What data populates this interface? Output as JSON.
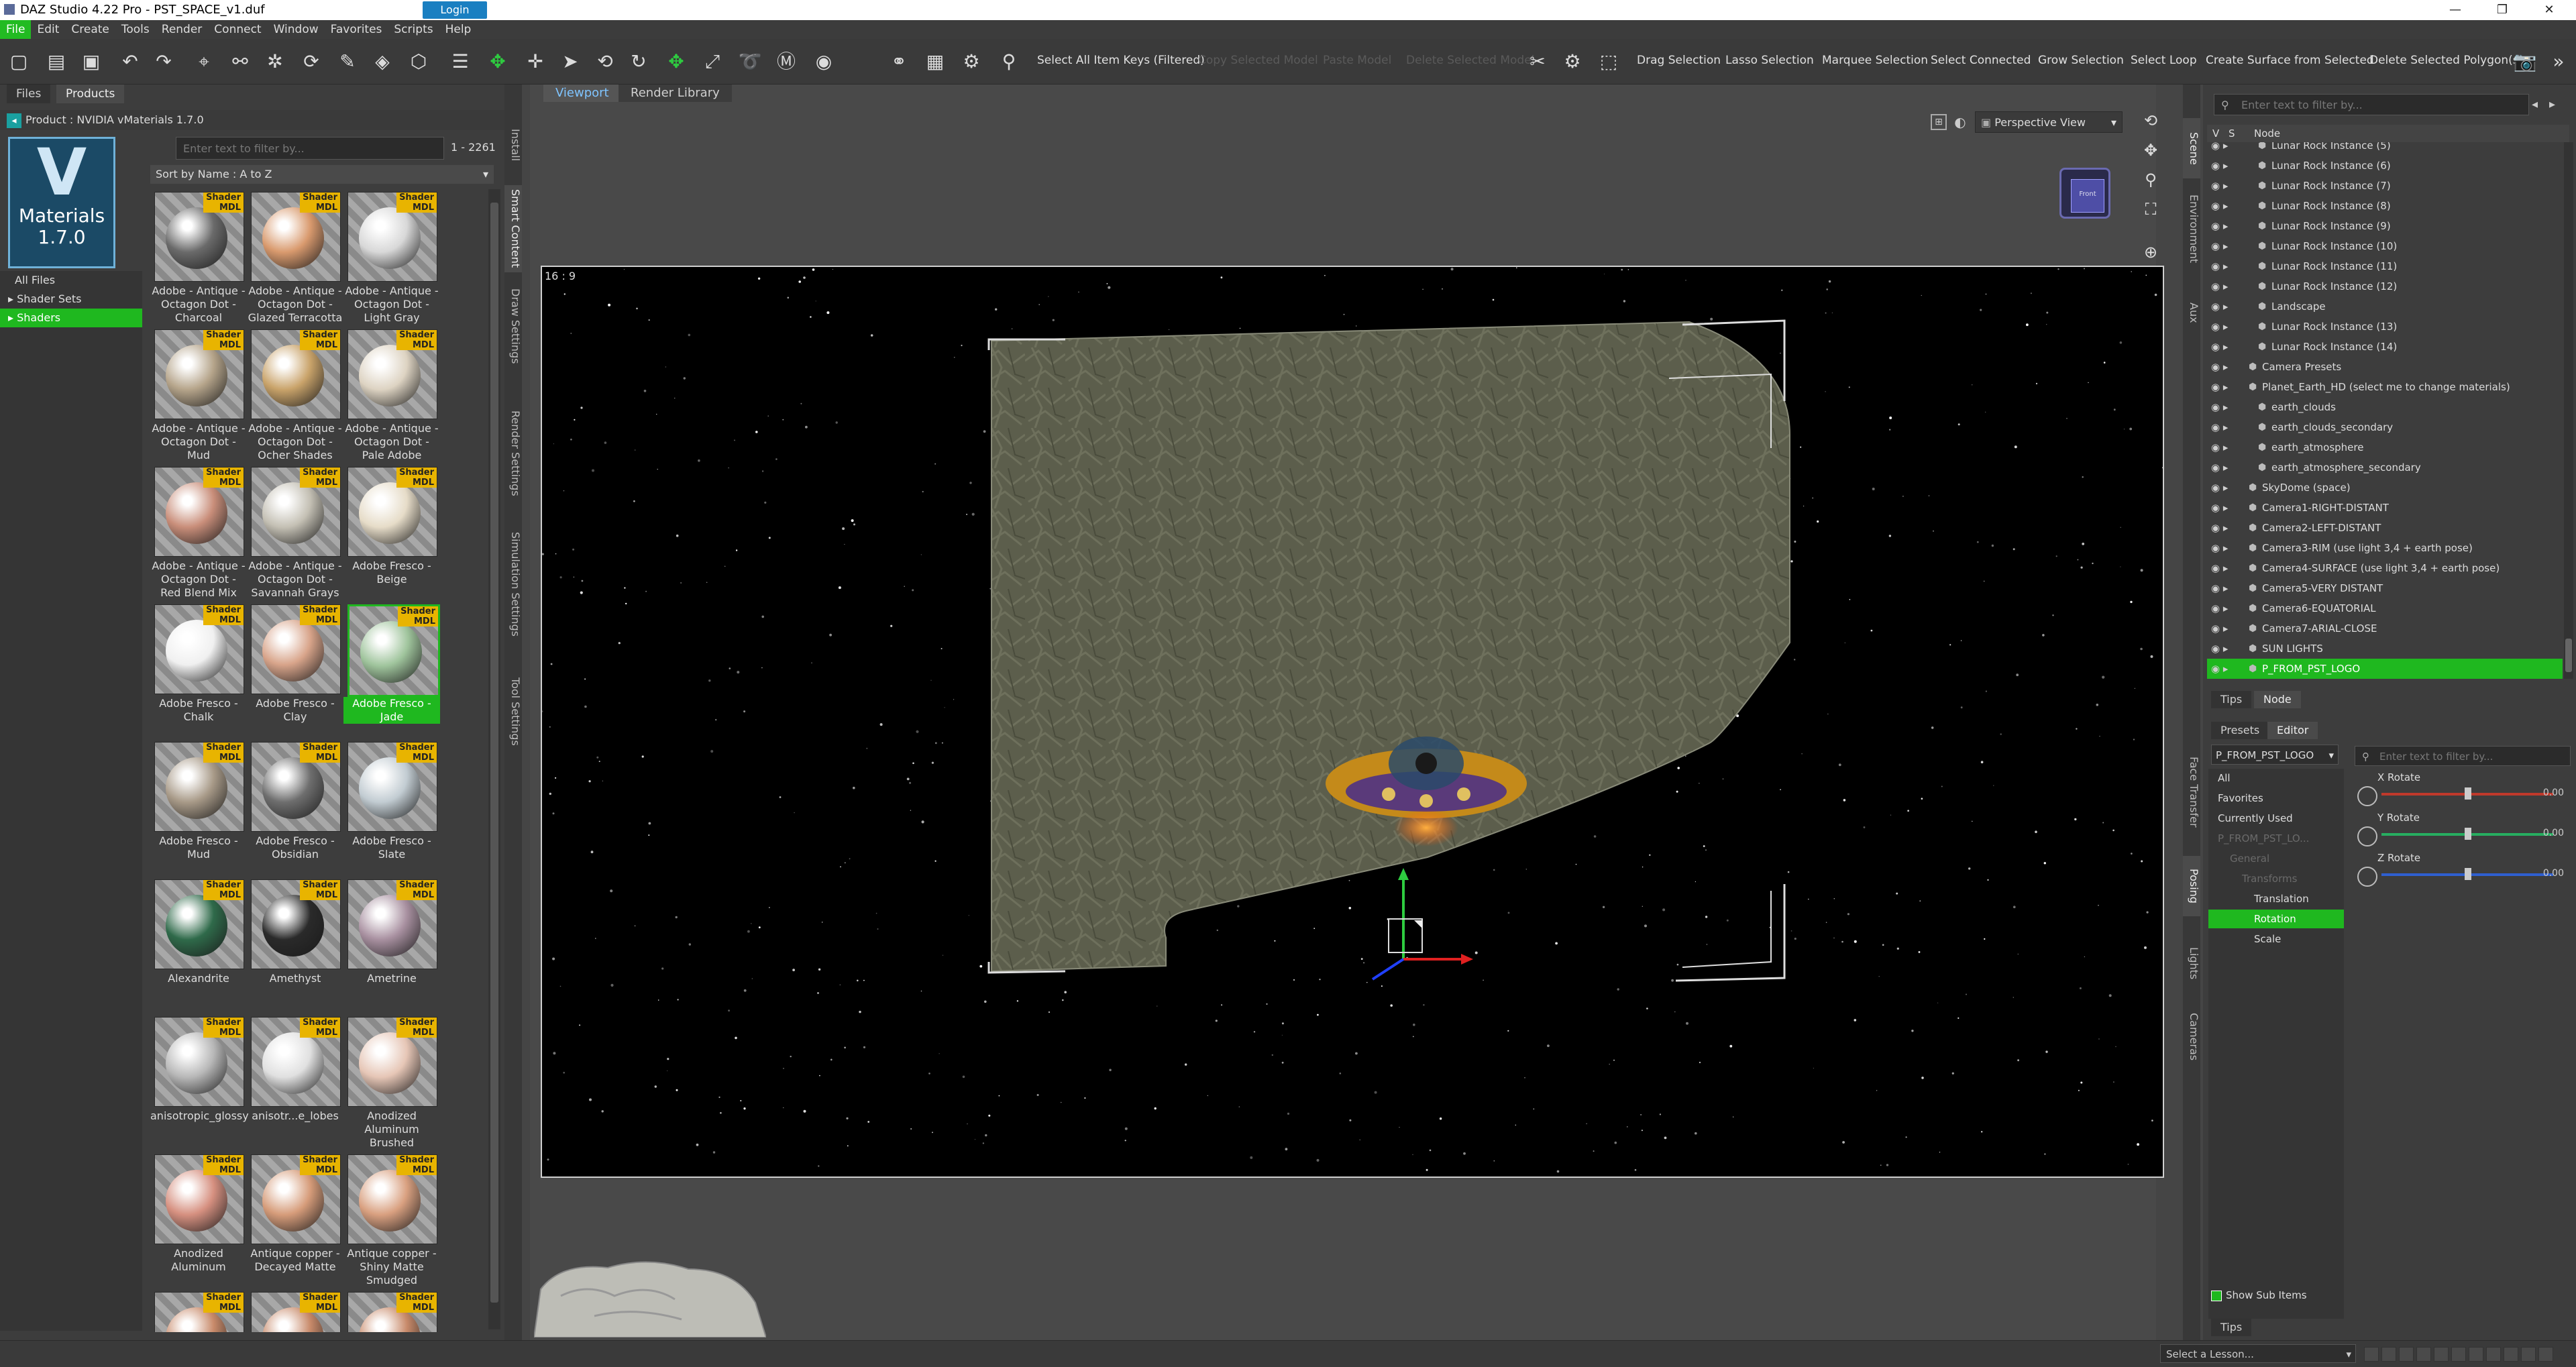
{
  "window": {
    "title": "DAZ Studio 4.22 Pro - PST_SPACE_v1.duf",
    "minimize": "—",
    "maximize": "❐",
    "close": "✕"
  },
  "menu": [
    "File",
    "Edit",
    "Create",
    "Tools",
    "Render",
    "Connect",
    "Window",
    "Favorites",
    "Scripts",
    "Help"
  ],
  "toolbar": {
    "select_keys": "Select All Item Keys (Filtered)",
    "dim_labels": [
      "Copy Selected Model",
      "Paste Model",
      "Delete Selected Model"
    ],
    "labels": [
      "Drag Selection",
      "Lasso Selection",
      "Marquee Selection",
      "Select Connected",
      "Grow Selection",
      "Select Loop",
      "Create Surface from Selected",
      "Delete Selected Polygon(s)"
    ]
  },
  "left": {
    "tabs": [
      "Files",
      "Products"
    ],
    "login": "Login",
    "product": "Product : NVIDIA vMaterials 1.7.0",
    "logo": {
      "letter": "V",
      "word": "Materials",
      "version": "1.7.0"
    },
    "tree": [
      {
        "label": "All Files",
        "selected": false,
        "prefix": ""
      },
      {
        "label": "Shader Sets",
        "selected": false,
        "prefix": "▸ "
      },
      {
        "label": "Shaders",
        "selected": true,
        "prefix": "▸ "
      }
    ],
    "filter_placeholder": "Enter text to filter by...",
    "count": "1 - 2261",
    "sort": "Sort by Name : A to Z",
    "badge": "Shader MDL",
    "items": [
      {
        "caption": "Adobe - Antique - Octagon Dot - Charcoal",
        "color": "#6a6a6a",
        "selected": false
      },
      {
        "caption": "Adobe - Antique - Octagon Dot - Glazed Terracotta",
        "color": "#d99a6e",
        "selected": false
      },
      {
        "caption": "Adobe - Antique - Octagon Dot - Light Gray",
        "color": "#d8d8d8",
        "selected": false
      },
      {
        "caption": "Adobe - Antique - Octagon Dot - Mud",
        "color": "#b5a48a",
        "selected": false
      },
      {
        "caption": "Adobe - Antique - Octagon Dot - Ocher Shades",
        "color": "#c9a36a",
        "selected": false
      },
      {
        "caption": "Adobe - Antique - Octagon Dot - Pale Adobe",
        "color": "#ddd3c2",
        "selected": false
      },
      {
        "caption": "Adobe - Antique - Octagon Dot - Red Blend Mix",
        "color": "#c98e7a",
        "selected": false
      },
      {
        "caption": "Adobe - Antique - Octagon Dot - Savannah Grays",
        "color": "#c4c0b4",
        "selected": false
      },
      {
        "caption": "Adobe Fresco - Beige",
        "color": "#e6dcc8",
        "selected": false
      },
      {
        "caption": "Adobe Fresco - Chalk",
        "color": "#f0f0f0",
        "selected": false
      },
      {
        "caption": "Adobe Fresco - Clay",
        "color": "#d8a48a",
        "selected": false
      },
      {
        "caption": "Adobe Fresco - Jade",
        "color": "#9fc49c",
        "selected": true
      },
      {
        "caption": "Adobe Fresco - Mud",
        "color": "#a89a88",
        "selected": false
      },
      {
        "caption": "Adobe Fresco - Obsidian",
        "color": "#6e6e6e",
        "selected": false
      },
      {
        "caption": "Adobe Fresco - Slate",
        "color": "#c2ccd2",
        "selected": false
      },
      {
        "caption": "Alexandrite",
        "color": "#2f6a4a",
        "selected": false
      },
      {
        "caption": "Amethyst",
        "color": "#2a2a2a",
        "selected": false
      },
      {
        "caption": "Ametrine",
        "color": "#a890a0",
        "selected": false
      },
      {
        "caption": "anisotropic_glossy",
        "color": "#b8b8b8",
        "selected": false
      },
      {
        "caption": "anisotr...e_lobes",
        "color": "#e0e0e0",
        "selected": false
      },
      {
        "caption": "Anodized Aluminum Brushed",
        "color": "#e6c6b6",
        "selected": false
      },
      {
        "caption": "Anodized Aluminum",
        "color": "#d69080",
        "selected": false
      },
      {
        "caption": "Antique copper - Decayed Matte",
        "color": "#d69c7a",
        "selected": false
      },
      {
        "caption": "Antique copper - Shiny Matte Smudged",
        "color": "#d9a080",
        "selected": false
      },
      {
        "caption": "",
        "color": "#c88a6a",
        "selected": false
      },
      {
        "caption": "",
        "color": "#c88a6a",
        "selected": false
      },
      {
        "caption": "",
        "color": "#c88a6a",
        "selected": false
      }
    ]
  },
  "side_tabs_left": [
    "Install",
    "Smart Content",
    "Draw Settings",
    "Render Settings",
    "Simulation Settings",
    "Tool Settings"
  ],
  "viewport": {
    "tabs": [
      "Viewport",
      "Render Library"
    ],
    "view": "Perspective View",
    "aspect": "16 : 9",
    "cube_label": "Front"
  },
  "side_tabs_right": [
    "Scene",
    "Environment",
    "Aux"
  ],
  "side_tabs_right2": [
    "Face Transfer",
    "Posing",
    "Lights",
    "Cameras"
  ],
  "scene": {
    "filter_placeholder": "Enter text to filter by...",
    "head_v": "V",
    "head_s": "S",
    "head_node": "Node",
    "rows": [
      {
        "name": "Lunar Rock Instance (5)",
        "indent": 2,
        "selected": false
      },
      {
        "name": "Lunar Rock Instance (6)",
        "indent": 2,
        "selected": false
      },
      {
        "name": "Lunar Rock Instance (7)",
        "indent": 2,
        "selected": false
      },
      {
        "name": "Lunar Rock Instance (8)",
        "indent": 2,
        "selected": false
      },
      {
        "name": "Lunar Rock Instance (9)",
        "indent": 2,
        "selected": false
      },
      {
        "name": "Lunar Rock Instance (10)",
        "indent": 2,
        "selected": false
      },
      {
        "name": "Lunar Rock Instance (11)",
        "indent": 2,
        "selected": false
      },
      {
        "name": "Lunar Rock Instance (12)",
        "indent": 2,
        "selected": false
      },
      {
        "name": "Landscape",
        "indent": 2,
        "selected": false
      },
      {
        "name": "Lunar Rock Instance (13)",
        "indent": 2,
        "selected": false
      },
      {
        "name": "Lunar Rock Instance (14)",
        "indent": 2,
        "selected": false
      },
      {
        "name": "Camera Presets",
        "indent": 1,
        "selected": false
      },
      {
        "name": "Planet_Earth_HD (select me to change materials)",
        "indent": 1,
        "selected": false
      },
      {
        "name": "earth_clouds",
        "indent": 2,
        "selected": false
      },
      {
        "name": "earth_clouds_secondary",
        "indent": 2,
        "selected": false
      },
      {
        "name": "earth_atmosphere",
        "indent": 2,
        "selected": false
      },
      {
        "name": "earth_atmosphere_secondary",
        "indent": 2,
        "selected": false
      },
      {
        "name": "SkyDome (space)",
        "indent": 1,
        "selected": false
      },
      {
        "name": "Camera1-RIGHT-DISTANT",
        "indent": 1,
        "selected": false
      },
      {
        "name": "Camera2-LEFT-DISTANT",
        "indent": 1,
        "selected": false
      },
      {
        "name": "Camera3-RIM (use light 3,4 + earth pose)",
        "indent": 1,
        "selected": false
      },
      {
        "name": "Camera4-SURFACE (use light 3,4 + earth pose)",
        "indent": 1,
        "selected": false
      },
      {
        "name": "Camera5-VERY DISTANT",
        "indent": 1,
        "selected": false
      },
      {
        "name": "Camera6-EQUATORIAL",
        "indent": 1,
        "selected": false
      },
      {
        "name": "Camera7-ARIAL-CLOSE",
        "indent": 1,
        "selected": false
      },
      {
        "name": "SUN LIGHTS",
        "indent": 1,
        "selected": false
      },
      {
        "name": "P_FROM_PST_LOGO",
        "indent": 1,
        "selected": true
      }
    ]
  },
  "mid_tabs": [
    "Tips",
    "Node"
  ],
  "params": {
    "tabs": [
      "Presets",
      "Editor"
    ],
    "dropdown": "P_FROM_PST_LOGO",
    "filter_placeholder": "Enter text to filter by...",
    "tree": [
      {
        "label": "All",
        "selected": false,
        "dim": false,
        "indent": 0
      },
      {
        "label": "Favorites",
        "selected": false,
        "dim": false,
        "indent": 0
      },
      {
        "label": "Currently Used",
        "selected": false,
        "dim": false,
        "indent": 0
      },
      {
        "label": "P_FROM_PST_LO...",
        "selected": false,
        "dim": true,
        "indent": 0
      },
      {
        "label": "General",
        "selected": false,
        "dim": true,
        "indent": 1
      },
      {
        "label": "Transforms",
        "selected": false,
        "dim": true,
        "indent": 2
      },
      {
        "label": "Translation",
        "selected": false,
        "dim": false,
        "indent": 3
      },
      {
        "label": "Rotation",
        "selected": true,
        "dim": false,
        "indent": 3
      },
      {
        "label": "Scale",
        "selected": false,
        "dim": false,
        "indent": 3
      }
    ],
    "sliders": [
      {
        "label": "X Rotate",
        "value": "0.00",
        "color": "#c0392b"
      },
      {
        "label": "Y Rotate",
        "value": "0.00",
        "color": "#27ae60"
      },
      {
        "label": "Z Rotate",
        "value": "0.00",
        "color": "#2f5fd0"
      }
    ],
    "show_sub_items": "Show Sub Items",
    "tips": "Tips"
  },
  "status": {
    "lesson": "Select a Lesson..."
  }
}
